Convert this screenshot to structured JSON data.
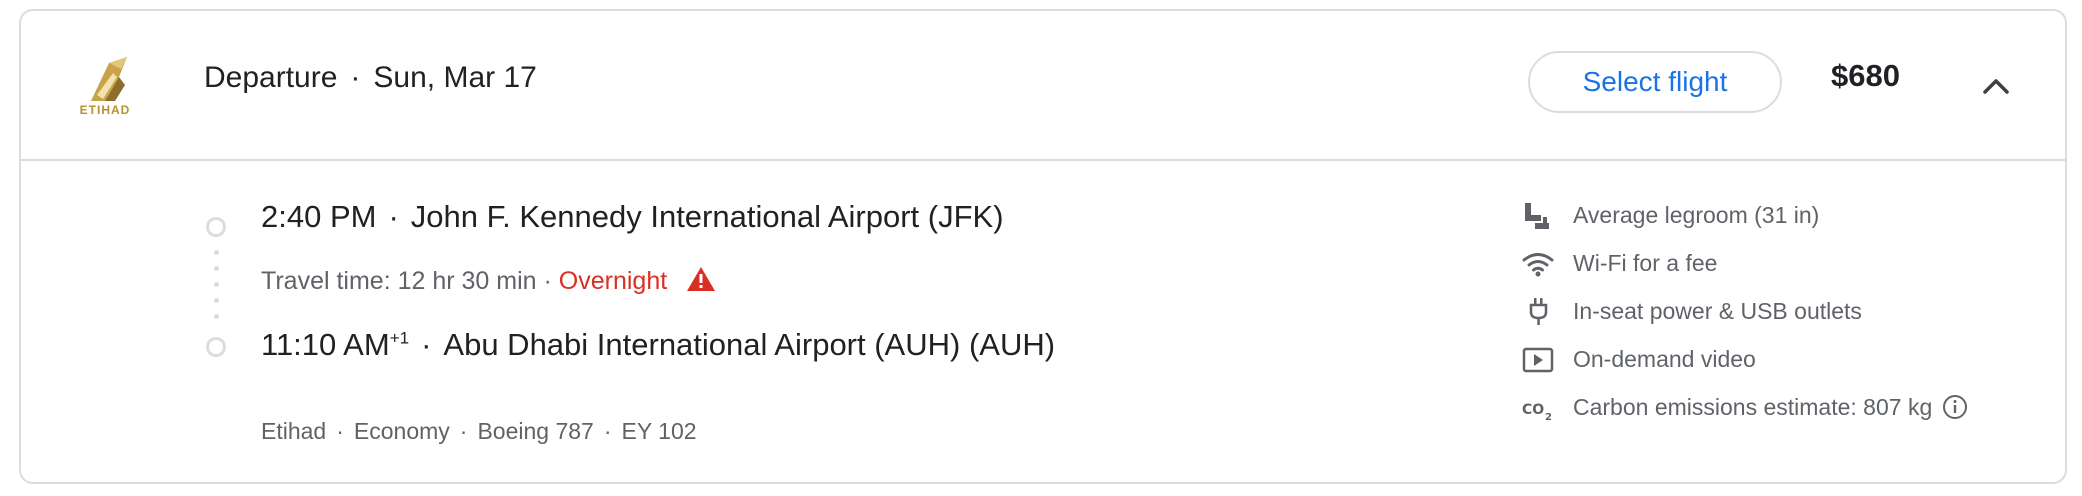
{
  "header": {
    "airline_logo_text": "ETIHAD",
    "departure_label": "Departure",
    "date": "Sun, Mar 17",
    "select_label": "Select flight",
    "price": "$680"
  },
  "itinerary": {
    "departure_time": "2:40 PM",
    "departure_airport": "John F. Kennedy International Airport (JFK)",
    "travel_time": "Travel time: 12 hr 30 min",
    "overnight_label": "Overnight",
    "arrival_time": "11:10 AM",
    "arrival_day_offset": "+1",
    "arrival_airport": "Abu Dhabi International Airport (AUH) (AUH)",
    "details": [
      "Etihad",
      "Economy",
      "Boeing 787",
      "EY 102"
    ]
  },
  "amenities": [
    {
      "icon": "seat-icon",
      "label": "Average legroom (31 in)"
    },
    {
      "icon": "wifi-icon",
      "label": "Wi-Fi for a fee"
    },
    {
      "icon": "plug-icon",
      "label": "In-seat power & USB outlets"
    },
    {
      "icon": "video-icon",
      "label": "On-demand video"
    },
    {
      "icon": "co2-icon",
      "label": "Carbon emissions estimate: 807 kg"
    }
  ],
  "colors": {
    "accent": "#1a73e8",
    "warning": "#d93025",
    "border": "#dadce0",
    "muted_text": "#5f6368",
    "logo_gold": "#b8912f"
  }
}
